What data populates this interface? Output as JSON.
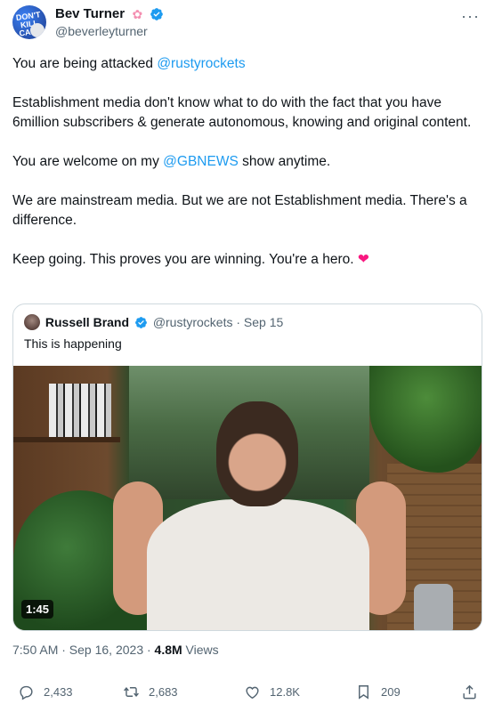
{
  "author": {
    "name": "Bev Turner",
    "handle": "@beverleyturner",
    "avatar_text": "DON'T KILL CASH"
  },
  "tweet": {
    "line1_prefix": "You are being attacked ",
    "line1_mention": "@rustyrockets",
    "para2": "Establishment media don't know what to do with the fact that you have 6million subscribers & generate autonomous, knowing and original content.",
    "para3_prefix": "You are welcome on my ",
    "para3_mention": "@GBNEWS",
    "para3_suffix": " show anytime.",
    "para4": "We are mainstream media. But we are not Establishment media. There's a difference.",
    "para5": "Keep going. This proves you are winning. You're a hero. "
  },
  "quote": {
    "name": "Russell Brand",
    "handle_date": "@rustyrockets · Sep 15",
    "text": "This is happening",
    "video_duration": "1:45"
  },
  "meta": {
    "time_date": "7:50 AM · Sep 16, 2023 · ",
    "views_count": "4.8M",
    "views_label": " Views"
  },
  "actions": {
    "replies": "2,433",
    "reposts": "2,683",
    "likes": "12.8K",
    "bookmarks": "209"
  },
  "colors": {
    "accent": "#1d9bf0",
    "text": "#0f1419",
    "muted": "#536471",
    "heart": "#f91880",
    "border": "#cfd9de"
  }
}
